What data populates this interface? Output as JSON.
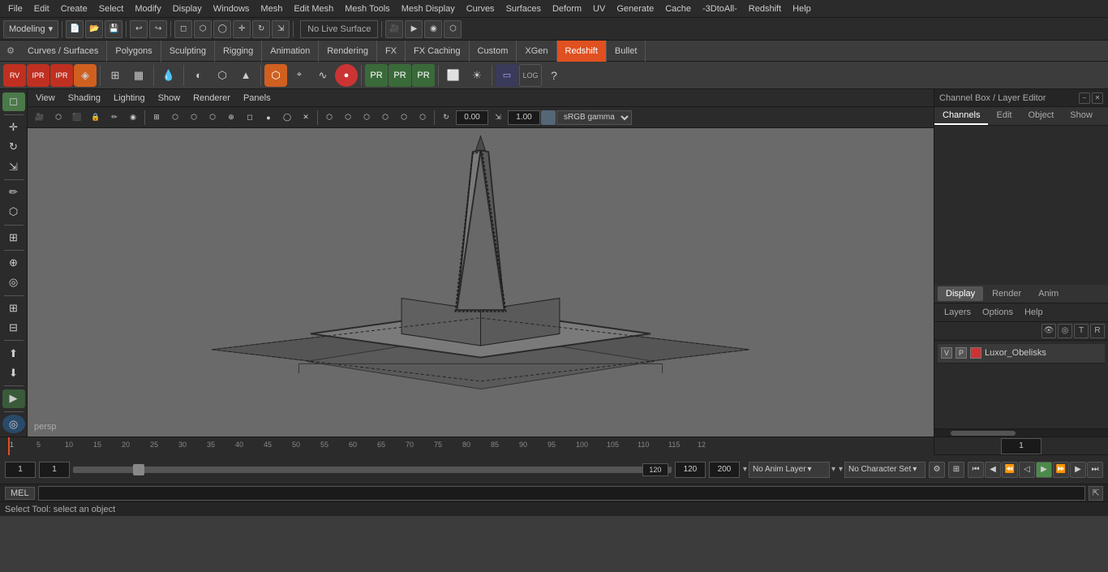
{
  "menubar": {
    "items": [
      "File",
      "Edit",
      "Create",
      "Select",
      "Modify",
      "Display",
      "Windows",
      "Mesh",
      "Edit Mesh",
      "Mesh Tools",
      "Mesh Display",
      "Curves",
      "Surfaces",
      "Deform",
      "UV",
      "Generate",
      "Cache",
      "-3DtoAll-",
      "Redshift",
      "Help"
    ]
  },
  "toolbar1": {
    "workspace_label": "Modeling",
    "no_live_surface": "No Live Surface"
  },
  "tabs": {
    "items": [
      "Curves / Surfaces",
      "Polygons",
      "Sculpting",
      "Rigging",
      "Animation",
      "Rendering",
      "FX",
      "FX Caching",
      "Custom",
      "XGen",
      "Redshift",
      "Bullet"
    ],
    "active": "Redshift"
  },
  "viewport": {
    "menus": [
      "View",
      "Shading",
      "Lighting",
      "Show",
      "Renderer",
      "Panels"
    ],
    "gamma_label": "sRGB gamma",
    "persp_label": "persp",
    "coord_x": "0.00",
    "coord_y": "1.00"
  },
  "channel_box": {
    "title": "Channel Box / Layer Editor",
    "tabs": [
      "Channels",
      "Edit",
      "Object",
      "Show"
    ],
    "active_tab": "Channels"
  },
  "layer_editor": {
    "tabs": [
      "Display",
      "Render",
      "Anim"
    ],
    "active_tab": "Display",
    "submenu": [
      "Layers",
      "Options",
      "Help"
    ],
    "layer_name": "Luxor_Obelisks",
    "layer_v": "V",
    "layer_p": "P",
    "layer_color": "#cc3333"
  },
  "timeline": {
    "ticks": [
      "5",
      "10",
      "15",
      "20",
      "25",
      "30",
      "35",
      "40",
      "45",
      "50",
      "55",
      "60",
      "65",
      "70",
      "75",
      "80",
      "85",
      "90",
      "95",
      "100",
      "105",
      "110",
      "115",
      "12"
    ],
    "start": "1",
    "end": "120",
    "current": "1"
  },
  "anim_controls": {
    "frame_start": "1",
    "frame_current": "1",
    "slider_value": "120",
    "frame_end": "120",
    "range_end": "200",
    "no_anim_layer": "No Anim Layer",
    "no_character_set": "No Character Set"
  },
  "mel_row": {
    "tag": "MEL",
    "input_value": ""
  },
  "status_bar": {
    "text": "Select Tool: select an object"
  },
  "icons": {
    "undo": "↩",
    "redo": "↪",
    "select": "◻",
    "move": "✛",
    "rotate": "↻",
    "scale": "⇲",
    "play": "▶",
    "prev": "⏮",
    "next": "⏭",
    "rewind": "⏪",
    "fforward": "⏩",
    "stop": "⏹",
    "gear": "⚙",
    "plus": "+",
    "minus": "−",
    "chevron": "▾"
  }
}
